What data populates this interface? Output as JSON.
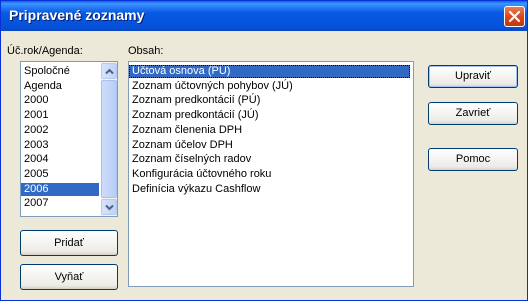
{
  "window": {
    "title": "Pripravené zoznamy"
  },
  "left": {
    "label": "Úč.rok/Agenda:",
    "items": [
      "Spoločné",
      "Agenda",
      "2000",
      "2001",
      "2002",
      "2003",
      "2004",
      "2005",
      "2006",
      "2007"
    ],
    "selected_index": 8
  },
  "right": {
    "label": "Obsah:",
    "items": [
      "Účtová osnova (PÚ)",
      "Zoznam účtovných pohybov (JÚ)",
      "Zoznam predkontácií (PÚ)",
      "Zoznam predkontácií (JÚ)",
      "Zoznam členenia DPH",
      "Zoznam účelov DPH",
      "Zoznam číselných radov",
      "Konfigurácia účtovného roku",
      "Definícia výkazu Cashflow"
    ],
    "selected_index": 0
  },
  "buttons": {
    "add": "Pridať",
    "remove": "Vyňať",
    "edit": "Upraviť",
    "close": "Zavrieť",
    "help": "Pomoc"
  },
  "icons": {
    "close": "close-icon",
    "scroll_up": "chevron-up-icon",
    "scroll_down": "chevron-down-icon"
  },
  "colors": {
    "titlebar": "#0651d9",
    "selection": "#316ac5",
    "window_bg": "#ece9d8"
  }
}
